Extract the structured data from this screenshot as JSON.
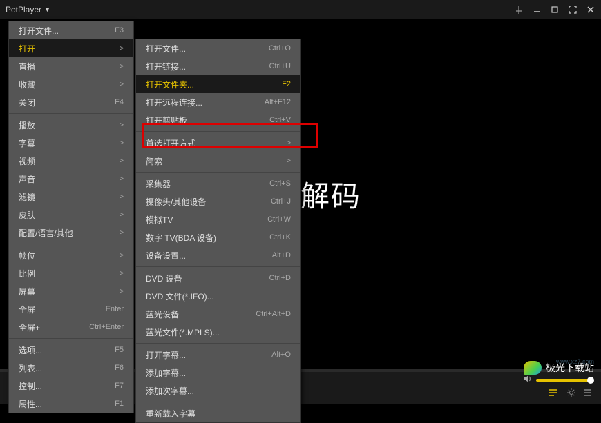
{
  "app": {
    "title": "PotPlayer"
  },
  "player": {
    "placeholder": "完美解码"
  },
  "watermark": {
    "brand": "极光下载站",
    "url": "www.xz7.com"
  },
  "menu1": [
    {
      "label": "打开文件...",
      "shortcut": "F3",
      "type": "item"
    },
    {
      "label": "打开",
      "shortcut": ">",
      "type": "item",
      "highlighted": true
    },
    {
      "label": "直播",
      "shortcut": ">",
      "type": "item"
    },
    {
      "label": "收藏",
      "shortcut": ">",
      "type": "item"
    },
    {
      "label": "关闭",
      "shortcut": "F4",
      "type": "item"
    },
    {
      "type": "sep"
    },
    {
      "label": "播放",
      "shortcut": ">",
      "type": "item"
    },
    {
      "label": "字幕",
      "shortcut": ">",
      "type": "item"
    },
    {
      "label": "视频",
      "shortcut": ">",
      "type": "item"
    },
    {
      "label": "声音",
      "shortcut": ">",
      "type": "item"
    },
    {
      "label": "滤镜",
      "shortcut": ">",
      "type": "item"
    },
    {
      "label": "皮肤",
      "shortcut": ">",
      "type": "item"
    },
    {
      "label": "配置/语言/其他",
      "shortcut": ">",
      "type": "item"
    },
    {
      "type": "sep"
    },
    {
      "label": "帧位",
      "shortcut": ">",
      "type": "item"
    },
    {
      "label": "比例",
      "shortcut": ">",
      "type": "item"
    },
    {
      "label": "屏幕",
      "shortcut": ">",
      "type": "item"
    },
    {
      "label": "全屏",
      "shortcut": "Enter",
      "type": "item"
    },
    {
      "label": "全屏+",
      "shortcut": "Ctrl+Enter",
      "type": "item"
    },
    {
      "type": "sep"
    },
    {
      "label": "选项...",
      "shortcut": "F5",
      "type": "item"
    },
    {
      "label": "列表...",
      "shortcut": "F6",
      "type": "item"
    },
    {
      "label": "控制...",
      "shortcut": "F7",
      "type": "item"
    },
    {
      "label": "属性...",
      "shortcut": "F1",
      "type": "item"
    }
  ],
  "menu2": [
    {
      "label": "打开文件...",
      "shortcut": "Ctrl+O",
      "type": "item"
    },
    {
      "label": "打开链接...",
      "shortcut": "Ctrl+U",
      "type": "item"
    },
    {
      "label": "打开文件夹...",
      "shortcut": "F2",
      "type": "item",
      "highlighted": true
    },
    {
      "label": "打开远程连接...",
      "shortcut": "Alt+F12",
      "type": "item"
    },
    {
      "label": "打开剪贴板",
      "shortcut": "Ctrl+V",
      "type": "item"
    },
    {
      "type": "sep"
    },
    {
      "label": "首选打开方式",
      "shortcut": ">",
      "type": "item"
    },
    {
      "label": "简索",
      "shortcut": ">",
      "type": "item"
    },
    {
      "type": "sep"
    },
    {
      "label": "采集器",
      "shortcut": "Ctrl+S",
      "type": "item"
    },
    {
      "label": "摄像头/其他设备",
      "shortcut": "Ctrl+J",
      "type": "item"
    },
    {
      "label": "模拟TV",
      "shortcut": "Ctrl+W",
      "type": "item"
    },
    {
      "label": "数字 TV(BDA 设备)",
      "shortcut": "Ctrl+K",
      "type": "item"
    },
    {
      "label": "设备设置...",
      "shortcut": "Alt+D",
      "type": "item"
    },
    {
      "type": "sep"
    },
    {
      "label": "DVD 设备",
      "shortcut": "Ctrl+D",
      "type": "item"
    },
    {
      "label": "DVD 文件(*.IFO)...",
      "shortcut": "",
      "type": "item"
    },
    {
      "label": "蓝光设备",
      "shortcut": "Ctrl+Alt+D",
      "type": "item"
    },
    {
      "label": "蓝光文件(*.MPLS)...",
      "shortcut": "",
      "type": "item"
    },
    {
      "type": "sep"
    },
    {
      "label": "打开字幕...",
      "shortcut": "Alt+O",
      "type": "item"
    },
    {
      "label": "添加字幕...",
      "shortcut": "",
      "type": "item"
    },
    {
      "label": "添加次字幕...",
      "shortcut": "",
      "type": "item"
    },
    {
      "type": "sep"
    },
    {
      "label": "重新载入字幕",
      "shortcut": "",
      "type": "item"
    }
  ]
}
